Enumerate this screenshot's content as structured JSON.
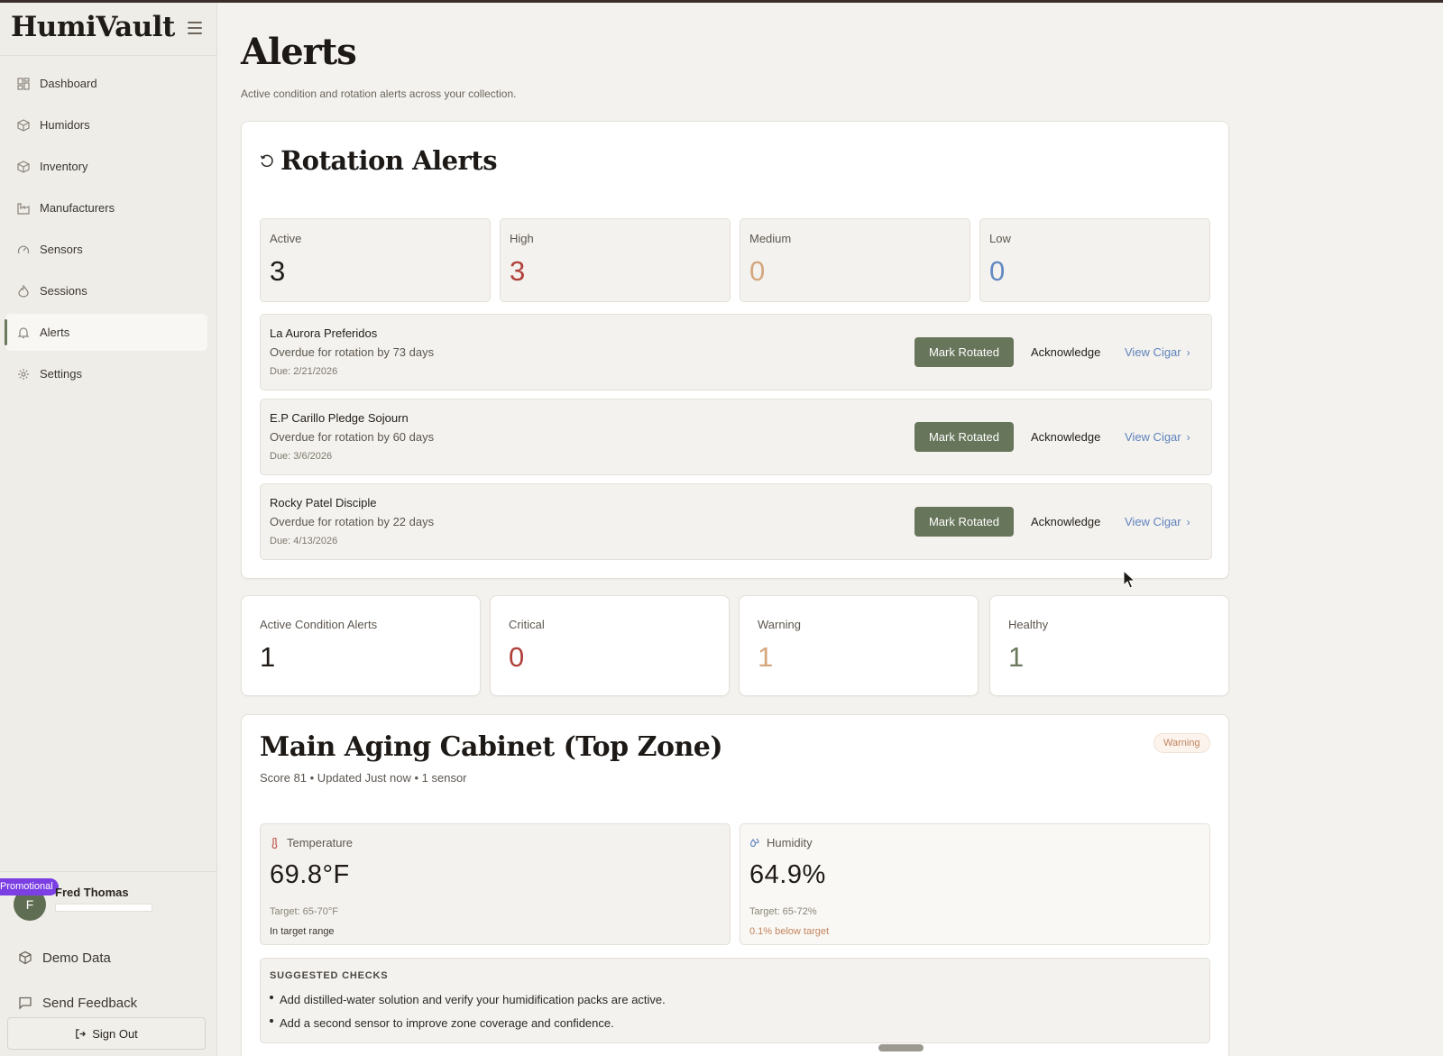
{
  "app": {
    "brand": "HumiVault"
  },
  "sidebar": {
    "items": [
      {
        "label": "Dashboard",
        "icon": "grid-icon"
      },
      {
        "label": "Humidors",
        "icon": "box-icon"
      },
      {
        "label": "Inventory",
        "icon": "box-icon"
      },
      {
        "label": "Manufacturers",
        "icon": "factory-icon"
      },
      {
        "label": "Sensors",
        "icon": "gauge-icon"
      },
      {
        "label": "Sessions",
        "icon": "flame-icon"
      },
      {
        "label": "Alerts",
        "icon": "bell-icon",
        "active": true
      },
      {
        "label": "Settings",
        "icon": "gear-icon"
      }
    ],
    "user": {
      "initial": "F",
      "name": "Fred Thomas",
      "badge": "Promotional"
    },
    "demo_data": "Demo Data",
    "send_feedback": "Send Feedback",
    "sign_out": "Sign Out"
  },
  "page": {
    "title": "Alerts",
    "subtitle": "Active condition and rotation alerts across your collection."
  },
  "rotation": {
    "title": "Rotation Alerts",
    "stats": [
      {
        "label": "Active",
        "value": "3",
        "color": "#1f1b18"
      },
      {
        "label": "High",
        "value": "3",
        "color": "#b0413a"
      },
      {
        "label": "Medium",
        "value": "0",
        "color": "#d4a77e"
      },
      {
        "label": "Low",
        "value": "0",
        "color": "#6389c4"
      }
    ],
    "alerts": [
      {
        "name": "La Aurora Preferidos",
        "desc": "Overdue for rotation by 73 days",
        "due": "Due: 2/21/2026"
      },
      {
        "name": "E.P Carillo Pledge Sojourn",
        "desc": "Overdue for rotation by 60 days",
        "due": "Due: 3/6/2026"
      },
      {
        "name": "Rocky Patel Disciple",
        "desc": "Overdue for rotation by 22 days",
        "due": "Due: 4/13/2026"
      }
    ],
    "mark_rotated": "Mark Rotated",
    "acknowledge": "Acknowledge",
    "view_cigar": "View Cigar"
  },
  "condition": {
    "stats": [
      {
        "label": "Active Condition Alerts",
        "value": "1",
        "color": "#1f1b18"
      },
      {
        "label": "Critical",
        "value": "0",
        "color": "#b0413a"
      },
      {
        "label": "Warning",
        "value": "1",
        "color": "#d4a77e"
      },
      {
        "label": "Healthy",
        "value": "1",
        "color": "#6b7a5e"
      }
    ]
  },
  "zone": {
    "title": "Main Aging Cabinet (Top Zone)",
    "meta": "Score 81 • Updated Just now • 1 sensor",
    "badge": "Warning",
    "temperature": {
      "label": "Temperature",
      "value": "69.8°F",
      "target": "Target: 65-70°F",
      "status": "In target range"
    },
    "humidity": {
      "label": "Humidity",
      "value": "64.9%",
      "target": "Target: 65-72%",
      "status": "0.1% below target"
    },
    "checks_title": "SUGGESTED CHECKS",
    "checks": [
      "Add distilled-water solution and verify your humidification packs are active.",
      "Add a second sensor to improve zone coverage and confidence."
    ]
  }
}
